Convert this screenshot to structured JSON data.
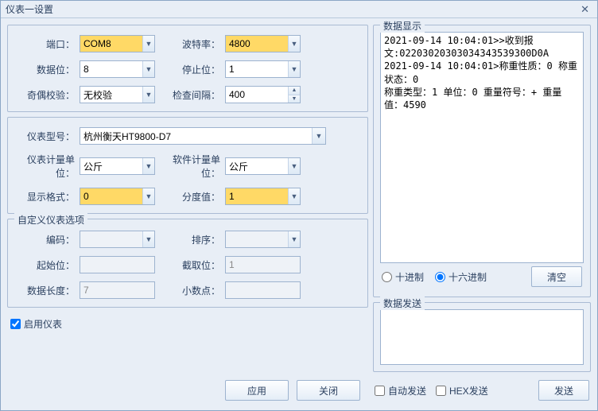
{
  "window": {
    "title": "仪表一设置"
  },
  "labels": {
    "port": "端口：",
    "baud": "波特率：",
    "databits": "数据位：",
    "stopbits": "停止位：",
    "parity": "奇偶校验：",
    "interval": "检查间隔：",
    "model": "仪表型号：",
    "unit1": "仪表计量单位：",
    "unit2": "软件计量单位：",
    "format": "显示格式：",
    "division": "分度值：",
    "custom": "自定义仪表选项",
    "encoding": "编码：",
    "sort": "排序：",
    "startbit": "起始位：",
    "cutbit": "截取位：",
    "datalen": "数据长度：",
    "decimal": "小数点：",
    "enable": "启用仪表",
    "apply": "应用",
    "close": "关闭",
    "dataDisplay": "数据显示",
    "dataSend": "数据发送",
    "decimalRadix": "十进制",
    "hexRadix": "十六进制",
    "clear": "清空",
    "autoSend": "自动发送",
    "hexSend": "HEX发送",
    "send": "发送"
  },
  "values": {
    "port": "COM8",
    "baud": "4800",
    "databits": "8",
    "stopbits": "1",
    "parity": "无校验",
    "interval": "400",
    "model": "杭州衡天HT9800-D7",
    "unit1": "公斤",
    "unit2": "公斤",
    "format": "0",
    "division": "1",
    "encoding": "",
    "sort": "",
    "startbit": "",
    "cutbit": "1",
    "datalen": "7",
    "decimal": ""
  },
  "display": "2021-09-14 10:04:01>>收到报\n文:02203020303034343539300D0A\n2021-09-14 10:04:01>称重性质：0 称重状态：0\n称重类型：1 单位：0 重量符号：+ 重量值：4590",
  "state": {
    "enable": true,
    "radix": "hex",
    "autoSend": false,
    "hexSend": false
  }
}
